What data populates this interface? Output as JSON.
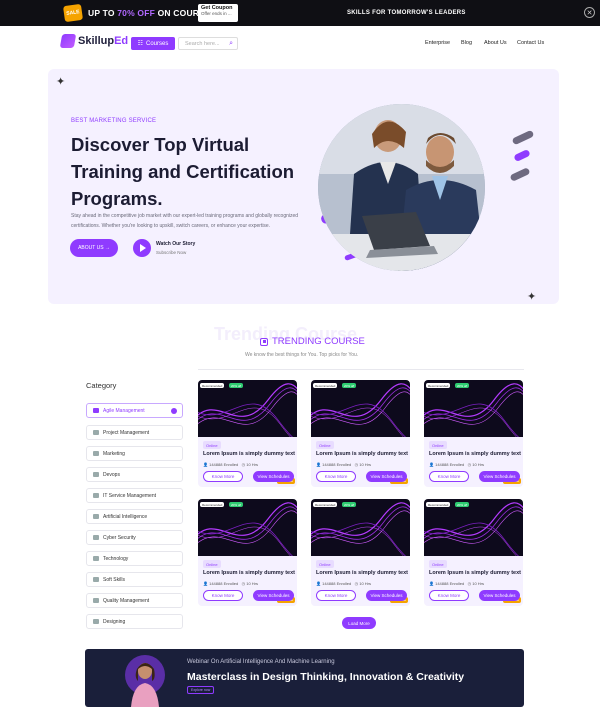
{
  "promo": {
    "badge": "SALE",
    "prefix": "UP TO ",
    "highlight": "70% OFF",
    "suffix": " ON COURSES",
    "coupon_title": "Get Coupon",
    "coupon_sub": "Offer ends in ...",
    "skills_text": "SKILLS FOR TOMORROW'S LEADERS",
    "close_icon": "✕"
  },
  "nav": {
    "logo_main": "Skillup",
    "logo_accent": "Ed",
    "courses_label": "Courses",
    "search_placeholder": "Search here...",
    "links": [
      "Enterprise",
      "Blog",
      "About Us",
      "Contact Us"
    ]
  },
  "hero": {
    "eyebrow": "BEST MARKETING SERVICE",
    "title": "Discover Top Virtual Training and Certification Programs.",
    "description": "Stay ahead in the competitive job market with our expert-led training programs and globally recognized certifications. Whether you're looking to upskill, switch careers, or enhance your expertise.",
    "about_label": "ABOUT US →",
    "watch_label": "Watch Our Story",
    "subscribe_label": "Subscribe Now"
  },
  "trending": {
    "ghost": "Trending Course",
    "title": "TRENDING COURSE",
    "subtitle": "We know the best things for You.  Top picks for You."
  },
  "categories": {
    "title": "Category",
    "items": [
      "Agile Management",
      "Project Management",
      "Marketing",
      "Devops",
      "IT Service Management",
      "Artificial Intelligence",
      "Cyber Security",
      "Technology",
      "Soft Skills",
      "Quality Management",
      "Designing"
    ]
  },
  "cards": [
    {
      "rec": "Recommended",
      "off": "20% off",
      "cert": "Certificate",
      "mode": "Online",
      "title": "Lorem Ipsum is simply dummy text",
      "enrolled": "144888 Enrolled",
      "hours": "10 Hrs",
      "know": "Know More",
      "sched": "View Schedules"
    },
    {
      "rec": "Recommended",
      "off": "20% off",
      "cert": "Certificate",
      "mode": "Online",
      "title": "Lorem Ipsum is simply dummy text",
      "enrolled": "144888 Enrolled",
      "hours": "10 Hrs",
      "know": "Know More",
      "sched": "View Schedules"
    },
    {
      "rec": "Recommended",
      "off": "20% off",
      "cert": "Certificate",
      "mode": "Online",
      "title": "Lorem Ipsum is simply dummy text",
      "enrolled": "144888 Enrolled",
      "hours": "10 Hrs",
      "know": "Know More",
      "sched": "View Schedules"
    },
    {
      "rec": "Recommended",
      "off": "20% off",
      "cert": "Certificate",
      "mode": "Online",
      "title": "Lorem Ipsum is simply dummy text",
      "enrolled": "144888 Enrolled",
      "hours": "10 Hrs",
      "know": "Know More",
      "sched": "View Schedules"
    },
    {
      "rec": "Recommended",
      "off": "20% off",
      "cert": "Certificate",
      "mode": "Online",
      "title": "Lorem Ipsum is simply dummy text",
      "enrolled": "144888 Enrolled",
      "hours": "10 Hrs",
      "know": "Know More",
      "sched": "View Schedules"
    },
    {
      "rec": "Recommended",
      "off": "20% off",
      "cert": "Certificate",
      "mode": "Online",
      "title": "Lorem Ipsum is simply dummy text",
      "enrolled": "144888 Enrolled",
      "hours": "10 Hrs",
      "know": "Know More",
      "sched": "View Schedules"
    }
  ],
  "load_more": "Load More",
  "webinar": {
    "kicker": "Webinar On Artificial Intelligence And Machine Learning",
    "headline": "Masterclass in Design Thinking, Innovation & Creativity",
    "tag": "Explore now"
  },
  "colors": {
    "accent": "#8f3bff",
    "hero_bg": "#f5f1ff",
    "promo_bg": "#0f0f14",
    "webinar_bg": "#1a1f3a"
  }
}
